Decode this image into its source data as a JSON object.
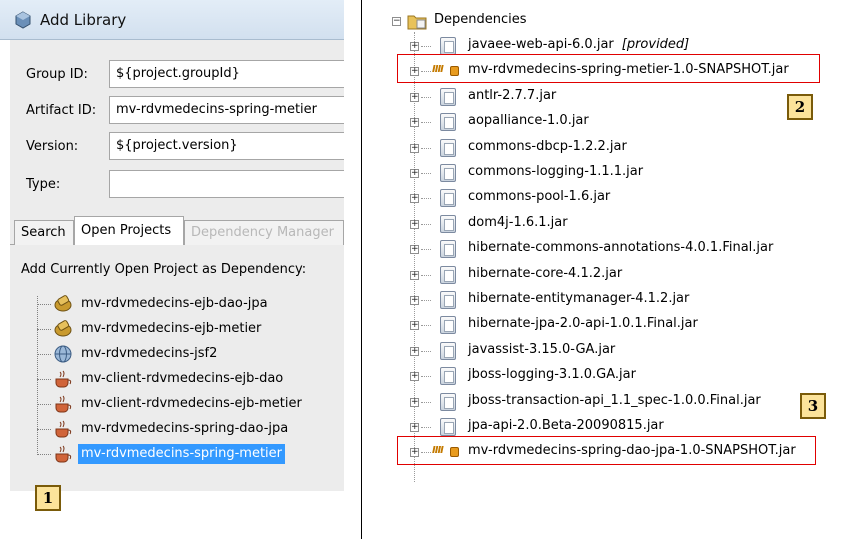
{
  "dialog": {
    "title": "Add Library",
    "fields": [
      {
        "label": "Group ID:",
        "value": "${project.groupId}"
      },
      {
        "label": "Artifact ID:",
        "value": "mv-rdvmedecins-spring-metier"
      },
      {
        "label": "Version:",
        "value": "${project.version}"
      },
      {
        "label": "Type:",
        "value": ""
      }
    ],
    "tabs": [
      {
        "label": "Search",
        "state": "normal"
      },
      {
        "label": "Open Projects",
        "state": "active"
      },
      {
        "label": "Dependency Manager",
        "state": "disabled"
      }
    ],
    "open_projects_label": "Add Currently Open Project as Dependency:",
    "projects": [
      {
        "name": "mv-rdvmedecins-ejb-dao-jpa",
        "icon": "ejb-module-icon",
        "selected": false
      },
      {
        "name": "mv-rdvmedecins-ejb-metier",
        "icon": "ejb-module-icon",
        "selected": false
      },
      {
        "name": "mv-rdvmedecins-jsf2",
        "icon": "web-app-icon",
        "selected": false
      },
      {
        "name": "mv-client-rdvmedecins-ejb-dao",
        "icon": "java-app-icon",
        "selected": false
      },
      {
        "name": "mv-client-rdvmedecins-ejb-metier",
        "icon": "java-app-icon",
        "selected": false
      },
      {
        "name": "mv-rdvmedecins-spring-dao-jpa",
        "icon": "java-app-icon",
        "selected": false
      },
      {
        "name": "mv-rdvmedecins-spring-metier",
        "icon": "java-app-icon",
        "selected": true
      }
    ]
  },
  "markers": {
    "m1": "1",
    "m2": "2",
    "m3": "3"
  },
  "tree": {
    "root_label": "Dependencies",
    "nodes": [
      {
        "label": "javaee-web-api-6.0.jar",
        "suffix": "[provided]",
        "icon": "jar-icon"
      },
      {
        "label": "mv-rdvmedecins-spring-metier-1.0-SNAPSHOT.jar",
        "icon": "maven-jar-icon",
        "highlighted": true
      },
      {
        "label": "antlr-2.7.7.jar",
        "icon": "jar-icon"
      },
      {
        "label": "aopalliance-1.0.jar",
        "icon": "jar-icon"
      },
      {
        "label": "commons-dbcp-1.2.2.jar",
        "icon": "jar-icon"
      },
      {
        "label": "commons-logging-1.1.1.jar",
        "icon": "jar-icon"
      },
      {
        "label": "commons-pool-1.6.jar",
        "icon": "jar-icon"
      },
      {
        "label": "dom4j-1.6.1.jar",
        "icon": "jar-icon"
      },
      {
        "label": "hibernate-commons-annotations-4.0.1.Final.jar",
        "icon": "jar-icon"
      },
      {
        "label": "hibernate-core-4.1.2.jar",
        "icon": "jar-icon"
      },
      {
        "label": "hibernate-entitymanager-4.1.2.jar",
        "icon": "jar-icon"
      },
      {
        "label": "hibernate-jpa-2.0-api-1.0.1.Final.jar",
        "icon": "jar-icon"
      },
      {
        "label": "javassist-3.15.0-GA.jar",
        "icon": "jar-icon"
      },
      {
        "label": "jboss-logging-3.1.0.GA.jar",
        "icon": "jar-icon"
      },
      {
        "label": "jboss-transaction-api_1.1_spec-1.0.0.Final.jar",
        "icon": "jar-icon"
      },
      {
        "label": "jpa-api-2.0.Beta-20090815.jar",
        "icon": "jar-icon"
      },
      {
        "label": "mv-rdvmedecins-spring-dao-jpa-1.0-SNAPSHOT.jar",
        "icon": "maven-jar-icon",
        "highlighted": true
      }
    ]
  },
  "colors": {
    "highlight_box": "#e00000",
    "selection": "#3399ff",
    "marker_fill": "#fce39a"
  }
}
